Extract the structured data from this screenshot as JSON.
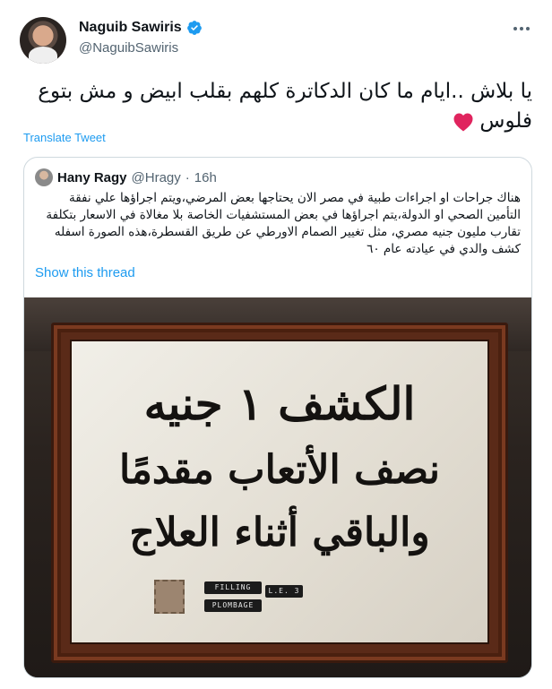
{
  "author": {
    "display_name": "Naguib Sawiris",
    "handle": "@NaguibSawiris",
    "avatar_icon": "profile-photo",
    "verified_icon": "verified-badge-icon"
  },
  "tweet": {
    "text": "يا بلاش ..ايام ما كان الدكاترة كلهم بقلب ابيض و مش بتوع فلوس",
    "emoji": "heart",
    "translate_label": "Translate Tweet"
  },
  "quote": {
    "display_name": "Hany Ragy",
    "handle": "@Hragy",
    "dot": "·",
    "time": "16h",
    "text": "هناك جراحات او اجراءات طبية في مصر الان يحتاجها بعض المرضي،ويتم اجراؤها علي نفقة التأمين الصحي او الدولة،يتم اجراؤها في بعض المستشفيات الخاصة بلا مغالاة في الاسعار بتكلفة تقارب مليون جنيه مصري، مثل تغيير الصمام الاورطي عن طريق القسطرة،هذه الصورة اسفله كشف والدي في عيادته عام ٦٠",
    "show_thread_label": "Show this thread"
  },
  "photo": {
    "sign_line_1": "الكشف ١ جنيه",
    "sign_line_2": "نصف الأتعاب مقدمًا",
    "sign_line_3": "والباقي أثناء العلاج",
    "label_filling": "FILLING",
    "label_plombage": "PLOMBAGE",
    "label_price": "L.E. 3"
  },
  "colors": {
    "accent": "#1d9bf0",
    "heart": "#e0245e",
    "muted": "#536471"
  }
}
